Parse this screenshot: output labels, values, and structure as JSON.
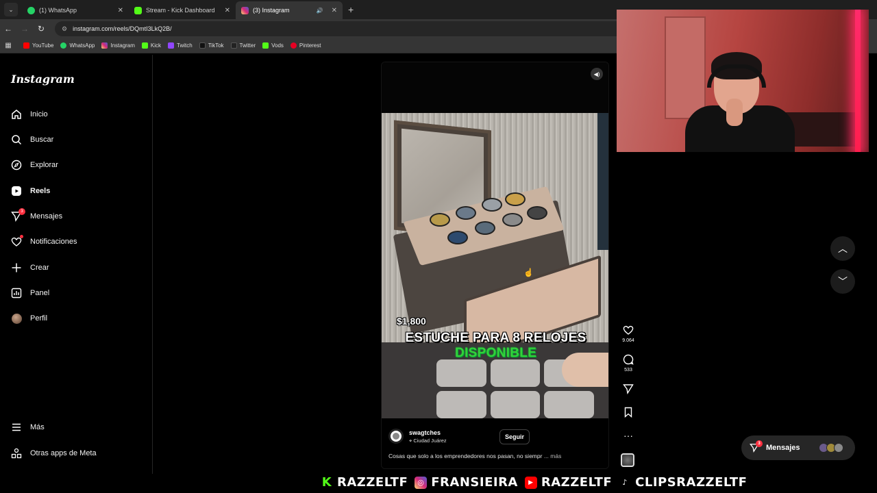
{
  "browser": {
    "tabs": [
      {
        "label": "(1) WhatsApp",
        "icon": "whatsapp-icon",
        "color": "#25d366"
      },
      {
        "label": "Stream - Kick Dashboard",
        "icon": "kick-icon",
        "color": "#53fc18"
      },
      {
        "label": "(3) Instagram",
        "icon": "instagram-icon",
        "color": "#e1306c"
      }
    ],
    "new_tab": "+",
    "url": "instagram.com/reels/DQmtI3LkQ2B/",
    "bookmarks": [
      {
        "label": "YouTube",
        "color": "#ff0000"
      },
      {
        "label": "WhatsApp",
        "color": "#25d366"
      },
      {
        "label": "Instagram",
        "color": "#e1306c"
      },
      {
        "label": "Kick",
        "color": "#53fc18"
      },
      {
        "label": "Twitch",
        "color": "#9146ff"
      },
      {
        "label": "TikTok",
        "color": "#111111"
      },
      {
        "label": "Twitter",
        "color": "#222222"
      },
      {
        "label": "Vods",
        "color": "#53fc18"
      },
      {
        "label": "Pinterest",
        "color": "#e60023"
      }
    ]
  },
  "sidebar": {
    "logo": "Instagram",
    "items": [
      {
        "label": "Inicio",
        "icon": "home-icon"
      },
      {
        "label": "Buscar",
        "icon": "search-icon"
      },
      {
        "label": "Explorar",
        "icon": "compass-icon"
      },
      {
        "label": "Reels",
        "icon": "reels-icon"
      },
      {
        "label": "Mensajes",
        "icon": "messenger-icon",
        "badge": "3"
      },
      {
        "label": "Notificaciones",
        "icon": "heart-icon"
      },
      {
        "label": "Crear",
        "icon": "plus-icon"
      },
      {
        "label": "Panel",
        "icon": "chart-icon"
      },
      {
        "label": "Perfil",
        "icon": "avatar-icon"
      }
    ],
    "bottom": [
      {
        "label": "Más",
        "icon": "menu-icon"
      },
      {
        "label": "Otras apps de Meta",
        "icon": "meta-apps-icon"
      }
    ]
  },
  "reel": {
    "price": "$1,800",
    "caption_line1": "ESTUCHE PARA 8 RELOJES",
    "caption_line2": "DISPONIBLE",
    "username": "swagtches",
    "location": "Ciudad Juárez",
    "follow_label": "Seguir",
    "description": "Cosas que solo a los emprendedores nos pasan, no siempr",
    "more_label": "... más",
    "likes": "9.064",
    "comments": "533"
  },
  "messages_pill": {
    "label": "Mensajes",
    "badge": "3"
  },
  "overlay": {
    "ticker": [
      {
        "text": "RAZZELTF",
        "icon": "kick-icon",
        "color": "#53fc18"
      },
      {
        "text": "FRANSIEIRA",
        "icon": "instagram-icon",
        "color": "#d62976"
      },
      {
        "text": "RAZZELTF",
        "icon": "youtube-icon",
        "color": "#ff0000"
      },
      {
        "text": "CLIPSRAZZELTF",
        "icon": "tiktok-icon",
        "color": "#000000"
      }
    ]
  },
  "colors": {
    "accent_green": "#35d03a",
    "badge_red": "#ff3040"
  }
}
